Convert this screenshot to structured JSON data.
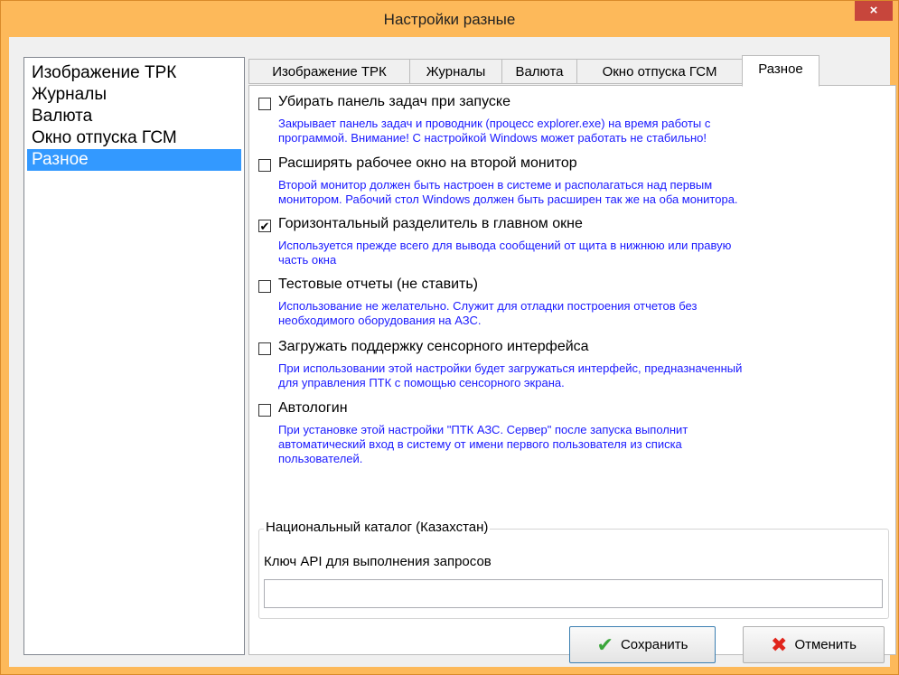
{
  "window": {
    "title": "Настройки разные",
    "close_glyph": "×"
  },
  "nav": {
    "items": [
      {
        "label": "Изображение ТРК"
      },
      {
        "label": "Журналы"
      },
      {
        "label": "Валюта"
      },
      {
        "label": "Окно отпуска ГСМ"
      },
      {
        "label": "Разное"
      }
    ],
    "selected": "Разное"
  },
  "tabs": [
    {
      "label": "Изображение ТРК"
    },
    {
      "label": "Журналы"
    },
    {
      "label": "Валюта"
    },
    {
      "label": "Окно отпуска ГСМ"
    },
    {
      "label": "Разное"
    }
  ],
  "active_tab": "Разное",
  "options": [
    {
      "label": "Убирать панель задач при запуске",
      "checked": false,
      "desc_lines": [
        "Закрывает панель задач и проводник (процесс explorer.exe) на время работы с",
        "программой. Внимание! С настройкой Windows может работать не стабильно!"
      ]
    },
    {
      "label": "Расширять рабочее окно на второй монитор",
      "checked": false,
      "desc_lines": [
        "Второй монитор должен быть настроен в системе и располагаться над первым",
        "монитором. Рабочий стол Windows должен быть расширен так же на оба монитора."
      ]
    },
    {
      "label": "Горизонтальный разделитель в главном окне",
      "checked": true,
      "desc_lines": [
        "Используется прежде всего для вывода сообщений от щита в нижнюю или правую",
        "часть окна"
      ]
    },
    {
      "label": "Тестовые отчеты (не ставить)",
      "checked": false,
      "desc_lines": [
        "Использование не желательно. Служит для отладки построения отчетов без",
        "необходимого оборудования на АЗС."
      ]
    },
    {
      "label": "Загружать поддержку сенсорного интерфейса",
      "checked": false,
      "desc_lines": [
        "При использовании этой настройки будет загружаться интерфейс, предназначенный",
        "для управления ПТК с помощью сенсорного экрана."
      ]
    },
    {
      "label": "Автологин",
      "checked": false,
      "desc_lines": [
        "При установке этой настройки \"ПТК АЗС. Сервер\" после запуска выполнит",
        "автоматический вход в систему от имени первого пользователя из списка",
        "пользователей."
      ]
    }
  ],
  "group": {
    "title": "Национальный каталог (Казахстан)",
    "api_label": "Ключ API для выполнения запросов",
    "api_value": ""
  },
  "buttons": {
    "save_label": "Сохранить",
    "cancel_label": "Отменить",
    "save_icon": "green-check-icon",
    "cancel_icon": "red-x-icon"
  },
  "colors": {
    "title_bar": "#fdb95a",
    "close_button": "#c7463c",
    "selection": "#3399ff",
    "description_text": "#1a1aff"
  }
}
